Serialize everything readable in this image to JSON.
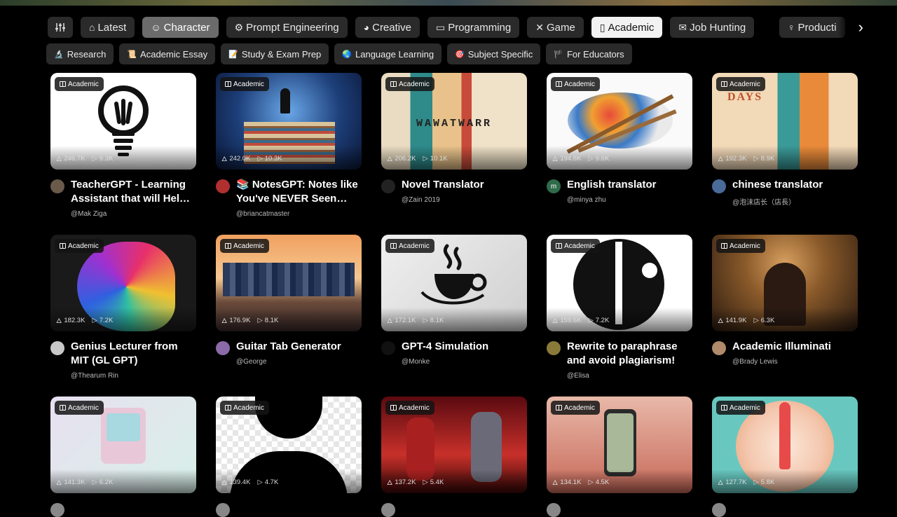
{
  "categories": [
    {
      "label": "Latest",
      "icon": "home-icon",
      "glyph": "⌂",
      "state": "normal"
    },
    {
      "label": "Character",
      "icon": "smile-icon",
      "glyph": "☺",
      "state": "dim"
    },
    {
      "label": "Prompt Engineering",
      "icon": "gear-icon",
      "glyph": "⚙",
      "state": "normal"
    },
    {
      "label": "Creative",
      "icon": "palette-icon",
      "glyph": "◕",
      "state": "normal"
    },
    {
      "label": "Programming",
      "icon": "monitor-icon",
      "glyph": "▭",
      "state": "normal"
    },
    {
      "label": "Game",
      "icon": "game-icon",
      "glyph": "✕",
      "state": "normal"
    },
    {
      "label": "Academic",
      "icon": "book-icon",
      "glyph": "▯",
      "state": "active"
    },
    {
      "label": "Job Hunting",
      "icon": "mail-icon",
      "glyph": "✉",
      "state": "normal"
    },
    {
      "label": "Producti",
      "icon": "bulb-icon",
      "glyph": "♀",
      "state": "normal"
    }
  ],
  "subcategories": [
    {
      "label": "Research",
      "emoji": "🔬"
    },
    {
      "label": "Academic Essay",
      "emoji": "📜"
    },
    {
      "label": "Study & Exam Prep",
      "emoji": "📝"
    },
    {
      "label": "Language Learning",
      "emoji": "🌏"
    },
    {
      "label": "Subject Specific",
      "emoji": "🎯"
    },
    {
      "label": "For Educators",
      "emoji": "🏴"
    }
  ],
  "badge_label": "Academic",
  "cards": [
    {
      "title": "TeacherGPT - Learning Assistant that will Help you",
      "author": "@Mak Ziga",
      "views": "246.7K",
      "plays": "9.3K",
      "avatar": "#6a5a4a"
    },
    {
      "title": "📚 NotesGPT: Notes like You've NEVER Seen Before",
      "author": "@briancatmaster",
      "views": "242.0K",
      "plays": "10.3K",
      "avatar": "#b03030"
    },
    {
      "title": "Novel Translator",
      "author": "@Zain 2019",
      "views": "206.2K",
      "plays": "10.1K",
      "avatar": "#222222"
    },
    {
      "title": "English translator",
      "author": "@minya zhu",
      "views": "194.8K",
      "plays": "9.6K",
      "avatar": "#2f6b4a",
      "letter": "m"
    },
    {
      "title": "chinese translator",
      "author": "@泡沫店长（店長）",
      "views": "192.3K",
      "plays": "8.9K",
      "avatar": "#4a6a9a"
    },
    {
      "title": "Genius Lecturer from MIT (GL GPT)",
      "author": "@Thearum Rin",
      "views": "182.3K",
      "plays": "7.2K",
      "avatar": "#c8c8c8"
    },
    {
      "title": "Guitar Tab Generator",
      "author": "@George",
      "views": "176.9K",
      "plays": "8.1K",
      "avatar": "#8a6aa8"
    },
    {
      "title": "GPT-4 Simulation",
      "author": "@Monke",
      "views": "172.1K",
      "plays": "8.1K",
      "avatar": "#111111"
    },
    {
      "title": "Rewrite to paraphrase and avoid plagiarism!",
      "author": "@Elisa",
      "views": "159.6K",
      "plays": "7.2K",
      "avatar": "#8a7a3a"
    },
    {
      "title": "Academic Illuminati",
      "author": "@Brady Lewis",
      "views": "141.9K",
      "plays": "6.3K",
      "avatar": "#b08a6a"
    },
    {
      "title": "",
      "author": "",
      "views": "141.3K",
      "plays": "6.2K",
      "avatar": "#888888"
    },
    {
      "title": "",
      "author": "",
      "views": "139.4K",
      "plays": "4.7K",
      "avatar": "#888888"
    },
    {
      "title": "",
      "author": "",
      "views": "137.2K",
      "plays": "5.4K",
      "avatar": "#888888"
    },
    {
      "title": "",
      "author": "",
      "views": "134.1K",
      "plays": "4.5K",
      "avatar": "#888888"
    },
    {
      "title": "",
      "author": "",
      "views": "127.7K",
      "plays": "5.8K",
      "avatar": "#888888"
    }
  ]
}
